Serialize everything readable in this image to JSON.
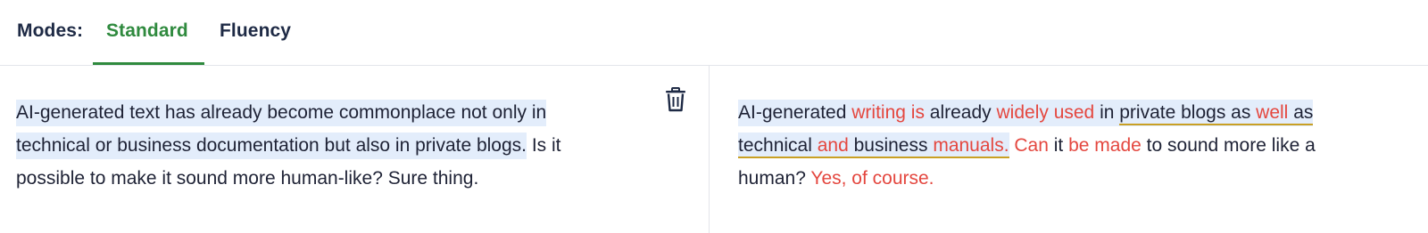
{
  "modes": {
    "label": "Modes:",
    "tabs": [
      {
        "label": "Standard",
        "active": true
      },
      {
        "label": "Fluency",
        "active": false
      }
    ]
  },
  "colors": {
    "active_tab": "#2f8a3e",
    "changed_text": "#e4473f",
    "highlight_bg": "#e3edfb",
    "underline": "#c9a024"
  },
  "left_pane": {
    "line1": "AI-generated text has already become commonplace not only in ",
    "line2_hl": "technical or business documentation but also in private blogs.",
    "line2_rest": " Is it",
    "line3": "possible to make it sound more human-like? Sure thing.",
    "delete_icon": "trash-icon"
  },
  "right_pane": {
    "l1": [
      "AI-generated ",
      "writing is",
      " already ",
      "widely used",
      " in ",
      "private blogs as ",
      "well",
      " as"
    ],
    "l2": [
      "technical ",
      "and",
      " business ",
      "manuals.",
      " ",
      "Can",
      " it ",
      "be made",
      " to sound more like a"
    ],
    "l3": [
      "human? ",
      "Yes, of course."
    ]
  }
}
